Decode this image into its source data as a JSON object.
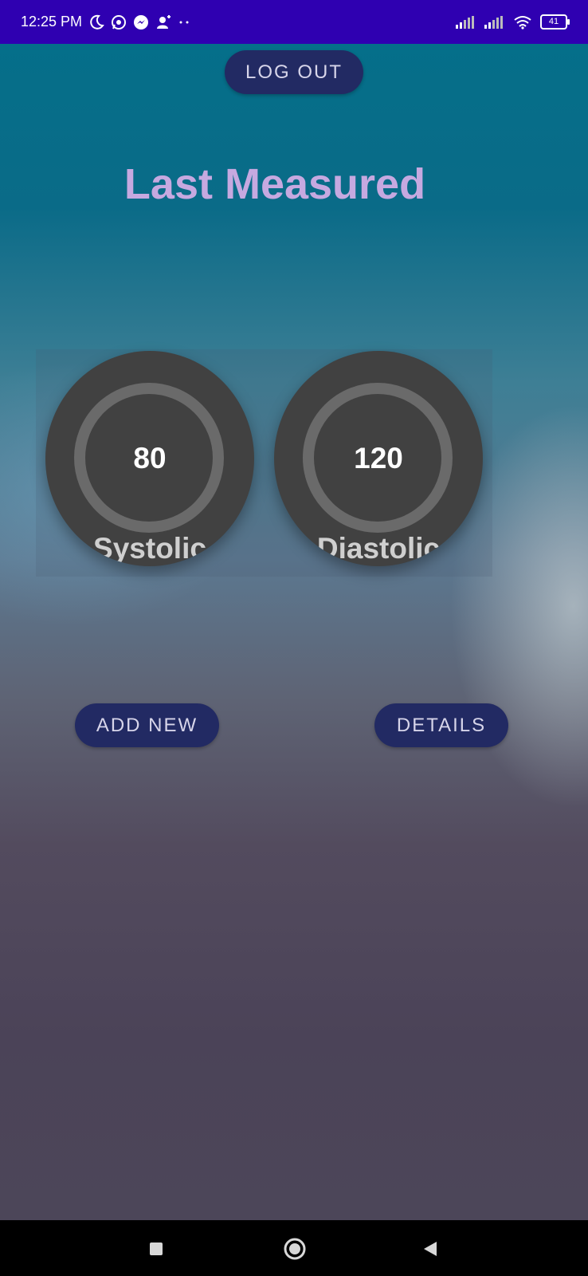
{
  "status_bar": {
    "time": "12:25 PM",
    "battery": "41",
    "icons_left": [
      "moon-icon",
      "whatsapp-icon",
      "messenger-icon",
      "person-add-icon",
      "more-dots-icon"
    ],
    "icons_right": [
      "signal-icon",
      "signal-icon",
      "wifi-icon",
      "battery-icon"
    ]
  },
  "header": {
    "logout_label": "LOG OUT"
  },
  "main": {
    "title": "Last Measured",
    "gauges": [
      {
        "value": "80",
        "label": "Systolic"
      },
      {
        "value": "120",
        "label": "Diastolic"
      }
    ]
  },
  "actions": {
    "add_new_label": "ADD NEW",
    "details_label": "DETAILS"
  },
  "colors": {
    "status_bar": "#2f00b1",
    "button": "#222a63",
    "title": "#c6a9e0",
    "gauge_bg": "#414141",
    "gauge_ring": "#6a6a6a"
  },
  "nav_bar": {
    "buttons": [
      "recent-apps-icon",
      "home-icon",
      "back-icon"
    ]
  }
}
